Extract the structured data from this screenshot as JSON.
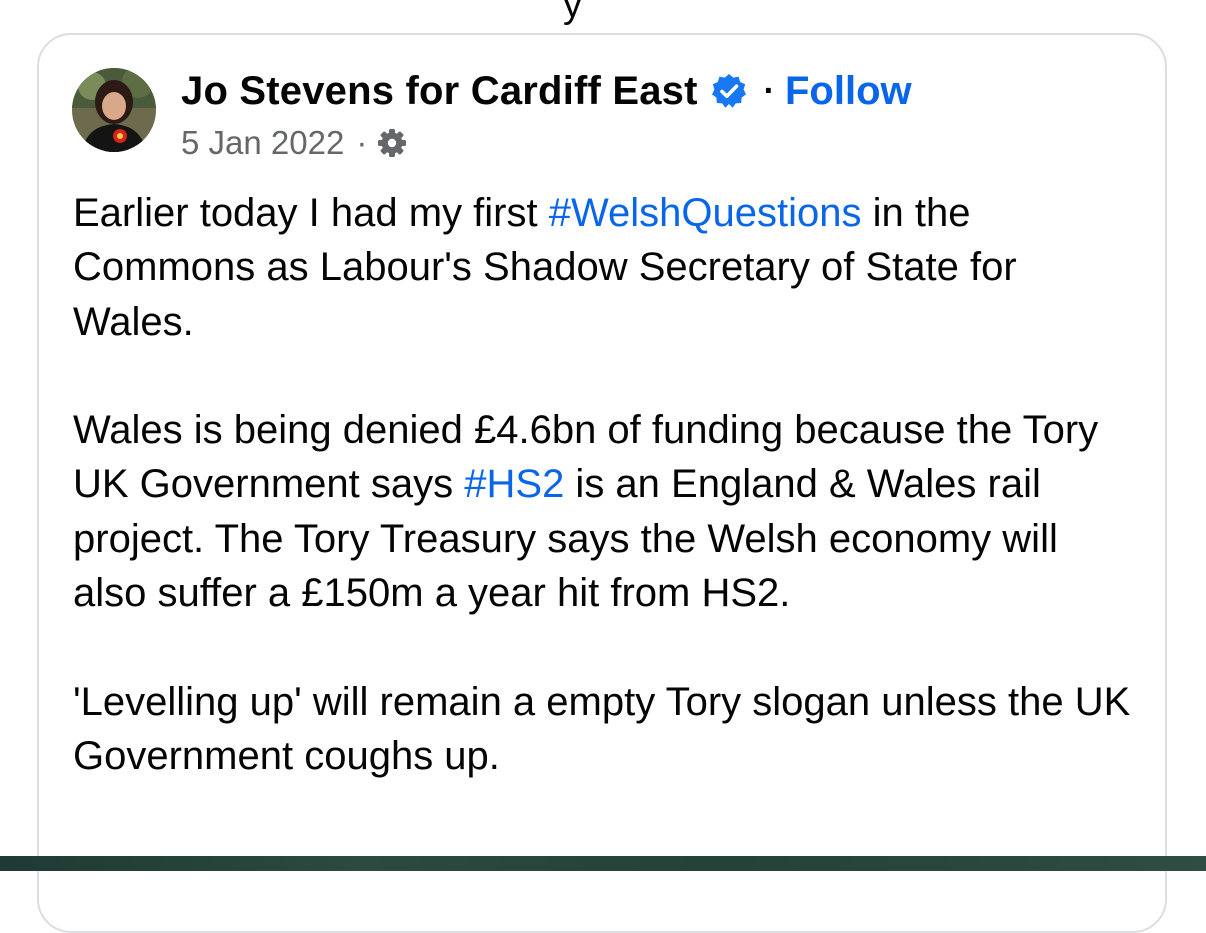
{
  "top_stub": "y",
  "post": {
    "author_name": "Jo Stevens for Cardiff East",
    "follow_label": "Follow",
    "separator": "·",
    "date": "5 Jan 2022",
    "audience_icon": "gear-icon",
    "verified_icon": "verified-badge-icon",
    "paragraphs": [
      {
        "before": "Earlier today I had my first ",
        "hashtag": "#WelshQuestions",
        "after": " in the Commons as Labour's Shadow Secretary of State for Wales."
      },
      {
        "before": "Wales is being denied £4.6bn of funding because the Tory UK Government says ",
        "hashtag": "#HS2",
        "after": " is an England & Wales rail project. The Tory Treasury says the Welsh economy will also suffer a £150m a year hit from HS2."
      },
      {
        "text": "'Levelling up' will remain a empty Tory slogan unless the UK Government coughs up."
      }
    ]
  },
  "colors": {
    "link_blue": "#0a66e8",
    "meta_gray": "#65676b",
    "card_border": "#dcdde1",
    "badge_blue": "#1877f2"
  }
}
